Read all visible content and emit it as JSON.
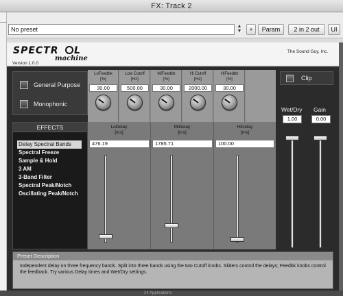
{
  "window": {
    "title": "FX: Track 2"
  },
  "toolbar": {
    "preset_value": "No preset",
    "stepper_up": "▲",
    "stepper_down": "▼",
    "plus_label": "+",
    "param_label": "Param",
    "io_label": "2 in 2 out",
    "ui_label": "UI"
  },
  "plugin": {
    "logo_word1": "SPECTR",
    "logo_o": "O",
    "logo_word2": "L",
    "logo_script": "machine",
    "version": "Version 1.0.0",
    "company": "The Sound Guy, Inc.",
    "modes": {
      "general_purpose": "General Purpose",
      "monophonic": "Monophonic"
    },
    "effects": {
      "header": "EFFECTS",
      "items": [
        "Delay Spectral Bands",
        "Spectral Freeze",
        "Sample & Hold",
        "3 AM",
        "3-Band Filter",
        "Spectral Peak/Notch",
        "Oscillating Peak/Notch"
      ],
      "selected_index": 0
    },
    "knobs": [
      {
        "name": "LoFeedbk",
        "unit": "[%]",
        "value": "30.00",
        "level": 0.3
      },
      {
        "name": "Low Cutoff",
        "unit": "[Hz]",
        "value": "500.00",
        "level": 0.3
      },
      {
        "name": "MiFeedbk",
        "unit": "[%]",
        "value": "30.00",
        "level": 0.3
      },
      {
        "name": "Hi Cutoff",
        "unit": "[Hz]",
        "value": "2000.00",
        "level": 0.3
      },
      {
        "name": "HiFeedbk",
        "unit": "[%]",
        "value": "30.00",
        "level": 0.3
      }
    ],
    "delays": [
      {
        "name": "LoDelay",
        "unit": "[ms]",
        "value": "476.19",
        "level": 0.05
      },
      {
        "name": "MiDelay",
        "unit": "[ms]",
        "value": "1785.71",
        "level": 0.18
      },
      {
        "name": "HiDelay",
        "unit": "[ms]",
        "value": "100.00",
        "level": 0.02
      }
    ],
    "clip_label": "Clip",
    "wetdry": {
      "label": "Wet/Dry",
      "value": "1.00",
      "level": 1.0
    },
    "gain": {
      "label": "Gain",
      "value": "0.00",
      "level": 1.0
    },
    "description": {
      "header": "Preset Description",
      "text": "Independent delay on three frequency bands. Split into three bands using the two Cutoff knobs. Sliders control the delays; Feedbk knobs control the feedback. Try various Delay times and Wet/Dry settings."
    }
  },
  "taskbar": {
    "item1": "24 Applications"
  },
  "colors": {
    "panel": "#2b2b2b",
    "grid": "#9a9a9a",
    "selected": "#d8d8d8"
  }
}
